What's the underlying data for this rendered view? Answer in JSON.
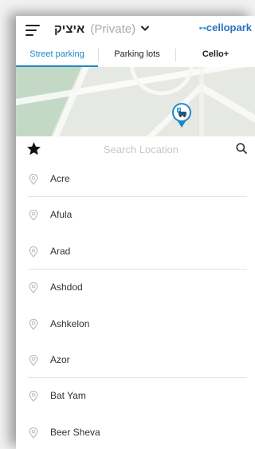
{
  "header": {
    "user_name": "איציק",
    "account_type": "(Private)",
    "brand": "cellopark"
  },
  "tabs": [
    {
      "label": "Street parking",
      "active": true
    },
    {
      "label": "Parking lots",
      "active": false
    },
    {
      "label": "Cello+",
      "active": false
    }
  ],
  "map": {
    "marker_icon": "parking-car-icon"
  },
  "search": {
    "placeholder": "Search Location",
    "value": ""
  },
  "locations": [
    {
      "label": "Acre",
      "separator": true
    },
    {
      "label": "Afula",
      "separator": false
    },
    {
      "label": "Arad",
      "separator": true
    },
    {
      "label": "Ashdod",
      "separator": false
    },
    {
      "label": "Ashkelon",
      "separator": false
    },
    {
      "label": "Azor",
      "separator": true
    },
    {
      "label": "Bat Yam",
      "separator": false
    },
    {
      "label": "Beer Sheva",
      "separator": false
    }
  ],
  "colors": {
    "accent": "#1e88c7",
    "brand": "#2f6fc4",
    "map_bg": "#e6e9e3",
    "map_green": "#c3d9c6"
  }
}
